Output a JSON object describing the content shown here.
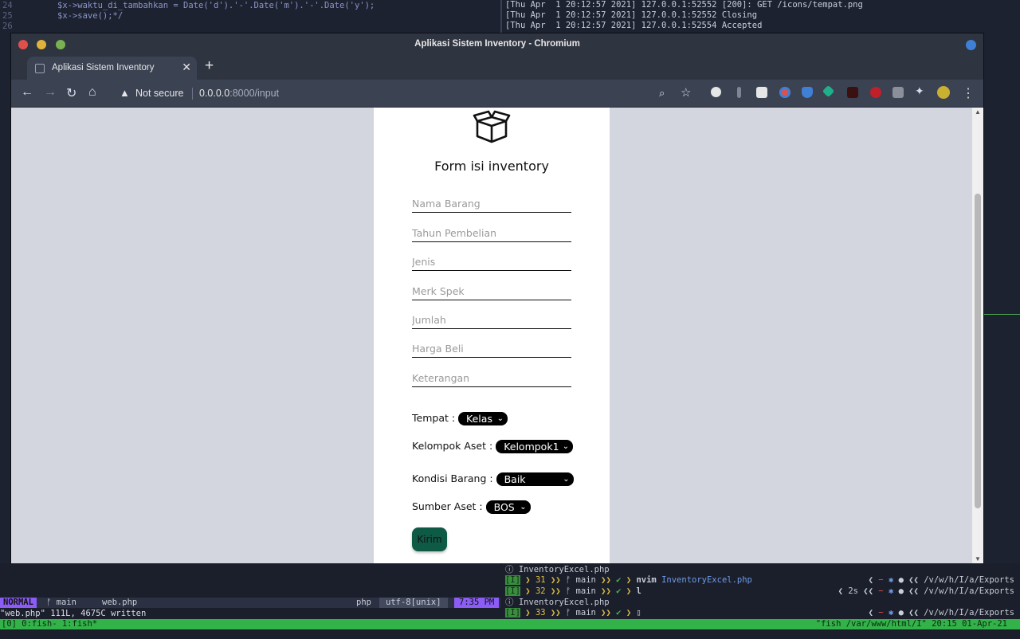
{
  "terminal": {
    "top_left_lines": [
      {
        "num": "24",
        "code": "$x->waktu_di_tambahkan = Date('d').'-'.Date('m').'-'.Date('y');"
      },
      {
        "num": "25",
        "code": "$x->save();*/"
      },
      {
        "num": "26",
        "code": ""
      }
    ],
    "top_right_lines": [
      "[Thu Apr  1 20:12:57 2021] 127.0.0.1:52552 [200]: GET /icons/tempat.png",
      "[Thu Apr  1 20:12:57 2021] 127.0.0.1:52552 Closing",
      "[Thu Apr  1 20:12:57 2021] 127.0.0.1:52554 Accepted"
    ],
    "vim_status": {
      "mode": "NORMAL",
      "branch": "ᚠ main",
      "file": "web.php",
      "filetype": "php",
      "encoding": "utf-8[unix]",
      "time": "7:35 PM"
    },
    "vim_message": "\"web.php\" 111L, 4675C written",
    "fish_lines": [
      {
        "text": "ⓘ InventoryExcel.php"
      },
      {
        "badge": "[I]",
        "count": "31",
        "branch": "main",
        "cmd": "nvim",
        "arg": "InventoryExcel.php",
        "right": "/v/w/h/I/a/Exports"
      },
      {
        "badge": "[I]",
        "count": "32",
        "branch": "main",
        "cmd": "l",
        "arg": "",
        "dur": "2s",
        "right": "/v/w/h/I/a/Exports"
      },
      {
        "text": "ⓘ InventoryExcel.php"
      },
      {
        "badge": "[I]",
        "count": "33",
        "branch": "main",
        "cmd": "",
        "arg": "",
        "right": "/v/w/h/I/a/Exports"
      }
    ],
    "tmux_left": "[0] 0:fish- 1:fish*",
    "tmux_right": "\"fish  /var/www/html/I\" 20:15 01-Apr-21"
  },
  "browser": {
    "window_title": "Aplikasi Sistem Inventory - Chromium",
    "tab_title": "Aplikasi Sistem Inventory",
    "new_tab": "+",
    "security_label": "Not secure",
    "url_host": "0.0.0.0",
    "url_path": ":8000/input"
  },
  "form": {
    "title": "Form isi inventory",
    "fields": [
      {
        "name": "nama-barang",
        "placeholder": "Nama Barang"
      },
      {
        "name": "tahun-pembelian",
        "placeholder": "Tahun Pembelian"
      },
      {
        "name": "jenis",
        "placeholder": "Jenis"
      },
      {
        "name": "merk-spek",
        "placeholder": "Merk Spek"
      },
      {
        "name": "jumlah",
        "placeholder": "Jumlah"
      },
      {
        "name": "harga-beli",
        "placeholder": "Harga Beli"
      },
      {
        "name": "keterangan",
        "placeholder": "Keterangan"
      }
    ],
    "tempat": {
      "label": "Tempat :",
      "value": "Kelas"
    },
    "kelompok": {
      "label": "Kelompok Aset :",
      "value": "Kelompok1"
    },
    "kondisi": {
      "label": "Kondisi Barang :",
      "value": "Baik"
    },
    "sumber": {
      "label": "Sumber Aset :",
      "value": "BOS"
    },
    "submit_label": "Kirim"
  },
  "colors": {
    "submit_bg": "#0e5a45",
    "select_bg": "#000000",
    "page_bg": "#d3d6de",
    "tmux_bar": "#33b24a",
    "vim_mode": "#8b5cf6"
  }
}
